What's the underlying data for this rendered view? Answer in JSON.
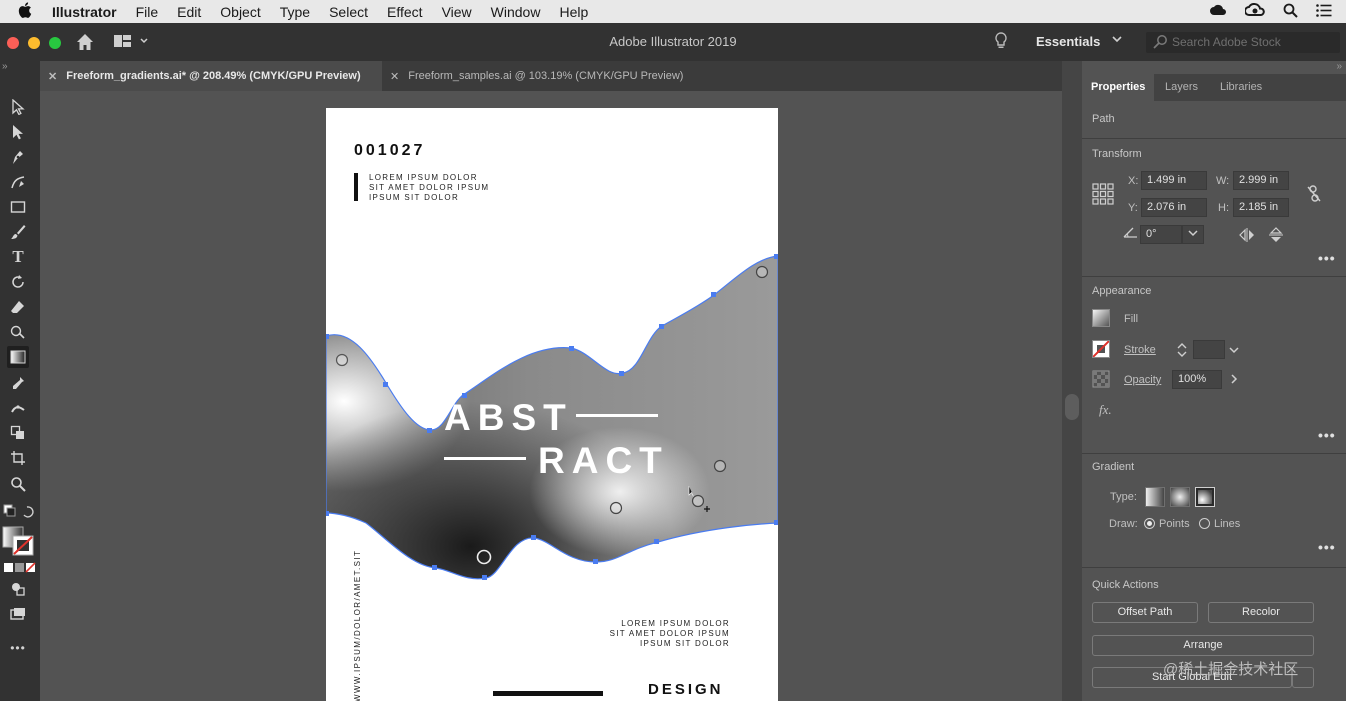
{
  "menubar": {
    "app": "Illustrator",
    "items": [
      "File",
      "Edit",
      "Object",
      "Type",
      "Select",
      "Effect",
      "View",
      "Window",
      "Help"
    ]
  },
  "appbar": {
    "title": "Adobe Illustrator 2019",
    "workspace": "Essentials",
    "search_placeholder": "Search Adobe Stock"
  },
  "tabs": [
    {
      "label": "Freeform_gradients.ai* @ 208.49% (CMYK/GPU Preview)",
      "active": true
    },
    {
      "label": "Freeform_samples.ai @ 103.19% (CMYK/GPU Preview)",
      "active": false
    }
  ],
  "toolbar": {
    "tools": [
      "selection-tool",
      "direct-selection-tool",
      "pen-tool",
      "curvature-tool",
      "rectangle-tool",
      "paintbrush-tool",
      "type-tool",
      "rotate-tool",
      "eraser-tool",
      "shape-builder-tool",
      "gradient-tool",
      "eyedropper-tool",
      "width-tool",
      "live-paint-tool",
      "artboard-tool",
      "zoom-tool"
    ],
    "selected": "gradient-tool",
    "more": "•••"
  },
  "artboard": {
    "number": "001027",
    "small_top": [
      "LOREM IPSUM DOLOR",
      "SIT AMET DOLOR IPSUM",
      "IPSUM SIT DOLOR"
    ],
    "heading_line1": "ABST",
    "heading_line2": "RACT",
    "vertical_text": "WWW.IPSUM/DOLOR/AMET.SIT",
    "small_bottom": [
      "LOREM IPSUM DOLOR",
      "SIT AMET DOLOR IPSUM",
      "IPSUM SIT DOLOR"
    ],
    "design": "DESIGN"
  },
  "panel": {
    "tabs": [
      "Properties",
      "Layers",
      "Libraries"
    ],
    "active_tab": "Properties",
    "object_type": "Path",
    "transform": {
      "title": "Transform",
      "x_label": "X:",
      "x": "1.499 in",
      "y_label": "Y:",
      "y": "2.076 in",
      "w_label": "W:",
      "w": "2.999 in",
      "h_label": "H:",
      "h": "2.185 in",
      "rotate": "0°"
    },
    "appearance": {
      "title": "Appearance",
      "fill": "Fill",
      "stroke": "Stroke",
      "opacity_label": "Opacity",
      "opacity": "100%",
      "fx": "fx."
    },
    "gradient": {
      "title": "Gradient",
      "type_label": "Type:",
      "draw_label": "Draw:",
      "points": "Points",
      "lines": "Lines",
      "selected_draw": "Points"
    },
    "quick_actions": {
      "title": "Quick Actions",
      "offset_path": "Offset Path",
      "recolor": "Recolor",
      "arrange": "Arrange",
      "start_global_edit": "Start Global Edit"
    },
    "more": "•••"
  },
  "watermark": "@稀土掘金技术社区",
  "colors": {
    "accent_selection": "#4a7cf0",
    "panel_bg": "#535353",
    "chrome_dark": "#323232"
  }
}
